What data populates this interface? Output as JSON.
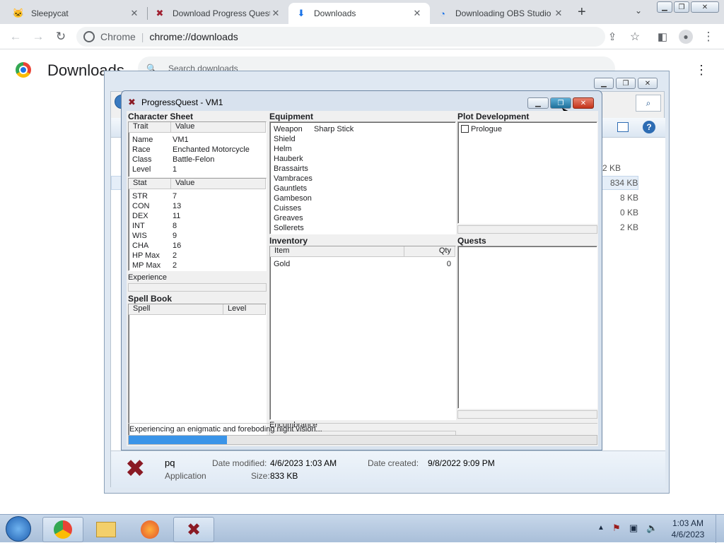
{
  "browser": {
    "tabs": [
      {
        "title": "Sleepycat",
        "icon": "cat-icon"
      },
      {
        "title": "Download Progress Quest",
        "icon": "pq-icon"
      },
      {
        "title": "Downloads",
        "icon": "download-icon"
      },
      {
        "title": "Downloading OBS Studio",
        "icon": "obs-icon"
      }
    ],
    "omnibox_prefix": "Chrome",
    "omnibox_url": "chrome://downloads",
    "page_title": "Downloads",
    "search_placeholder": "Search downloads"
  },
  "bg_dialog": {
    "sizes": [
      "2 KB",
      "834 KB",
      "8 KB",
      "0 KB",
      "2 KB"
    ],
    "file_name": "pq",
    "file_type": "Application",
    "date_modified_label": "Date modified:",
    "date_modified": "4/6/2023 1:03 AM",
    "date_created_label": "Date created:",
    "date_created": "9/8/2022 9:09 PM",
    "size_label": "Size:",
    "size": "833 KB"
  },
  "pq": {
    "title": "ProgressQuest - VM1",
    "character_sheet": "Character Sheet",
    "trait_header": "Trait",
    "value_header": "Value",
    "traits": [
      {
        "k": "Name",
        "v": "VM1"
      },
      {
        "k": "Race",
        "v": "Enchanted Motorcycle"
      },
      {
        "k": "Class",
        "v": "Battle-Felon"
      },
      {
        "k": "Level",
        "v": "1"
      }
    ],
    "stat_header": "Stat",
    "stats": [
      {
        "k": "STR",
        "v": "7"
      },
      {
        "k": "CON",
        "v": "13"
      },
      {
        "k": "DEX",
        "v": "11"
      },
      {
        "k": "INT",
        "v": "8"
      },
      {
        "k": "WIS",
        "v": "9"
      },
      {
        "k": "CHA",
        "v": "16"
      },
      {
        "k": "HP Max",
        "v": "2"
      },
      {
        "k": "MP Max",
        "v": "2"
      }
    ],
    "experience_label": "Experience",
    "spell_book": "Spell Book",
    "spell_header": "Spell",
    "level_header": "Level",
    "equipment": "Equipment",
    "equip": [
      {
        "k": "Weapon",
        "v": "Sharp Stick"
      },
      {
        "k": "Shield",
        "v": ""
      },
      {
        "k": "Helm",
        "v": ""
      },
      {
        "k": "Hauberk",
        "v": ""
      },
      {
        "k": "Brassairts",
        "v": ""
      },
      {
        "k": "Vambraces",
        "v": ""
      },
      {
        "k": "Gauntlets",
        "v": ""
      },
      {
        "k": "Gambeson",
        "v": ""
      },
      {
        "k": "Cuisses",
        "v": ""
      },
      {
        "k": "Greaves",
        "v": ""
      },
      {
        "k": "Sollerets",
        "v": ""
      }
    ],
    "inventory": "Inventory",
    "item_header": "Item",
    "qty_header": "Qty",
    "inv": [
      {
        "k": "Gold",
        "v": "0"
      }
    ],
    "encumbrance_label": "Encumbrance",
    "plot": "Plot Development",
    "prologue": "Prologue",
    "quests": "Quests",
    "status": "Experiencing an enigmatic and foreboding night vision...",
    "progress": 0.21
  },
  "taskbar": {
    "time": "1:03 AM",
    "date": "4/6/2023"
  }
}
